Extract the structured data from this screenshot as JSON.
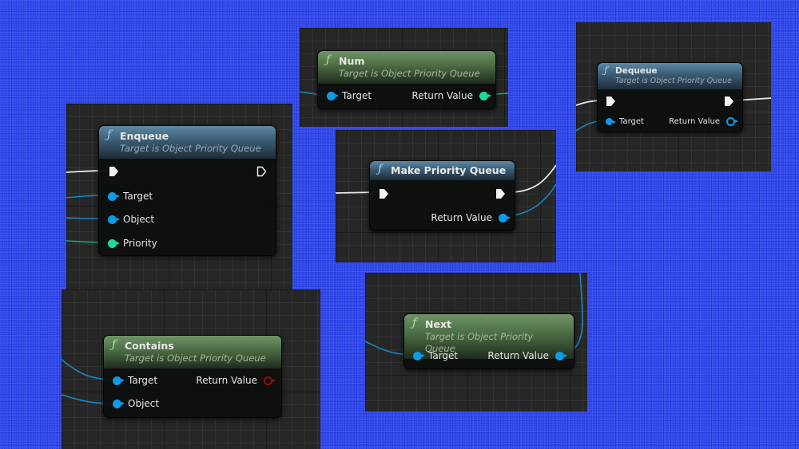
{
  "canvas": {
    "background_color": "#2f45e6",
    "graph_panel_color": "#262626"
  },
  "colors": {
    "object_pin": "#0d9be8",
    "integer_pin": "#1fd8a0",
    "boolean_pin": "#8b1010",
    "exec_pin": "#f2f2f2",
    "impure_header": "#4a7190",
    "pure_header": "#5a8052"
  },
  "nodes": {
    "num": {
      "icon": "function-icon",
      "fn_glyph": "ƒ",
      "title": "Num",
      "subtitle": "Target is Object Priority Queue",
      "inputs": [
        {
          "label": "Target",
          "type": "object"
        }
      ],
      "outputs": [
        {
          "label": "Return Value",
          "type": "integer"
        }
      ]
    },
    "dequeue": {
      "icon": "function-icon",
      "fn_glyph": "ƒ",
      "title": "Dequeue",
      "subtitle": "Target is Object Priority Queue",
      "inputs": [
        {
          "label": "Target",
          "type": "object"
        }
      ],
      "outputs": [
        {
          "label": "Return Value",
          "type": "object-unconnected"
        }
      ]
    },
    "enqueue": {
      "icon": "function-icon",
      "fn_glyph": "ƒ",
      "title": "Enqueue",
      "subtitle": "Target is Object Priority Queue",
      "inputs": [
        {
          "label": "Target",
          "type": "object"
        },
        {
          "label": "Object",
          "type": "object"
        },
        {
          "label": "Priority",
          "type": "integer"
        }
      ],
      "outputs": []
    },
    "make_priority_queue": {
      "icon": "function-icon",
      "fn_glyph": "ƒ",
      "title": "Make Priority Queue",
      "inputs": [],
      "outputs": [
        {
          "label": "Return Value",
          "type": "object"
        }
      ]
    },
    "contains": {
      "icon": "function-icon",
      "fn_glyph": "ƒ",
      "title": "Contains",
      "subtitle": "Target is Object Priority Queue",
      "inputs": [
        {
          "label": "Target",
          "type": "object"
        },
        {
          "label": "Object",
          "type": "object"
        }
      ],
      "outputs": [
        {
          "label": "Return Value",
          "type": "boolean-unconnected"
        }
      ]
    },
    "next": {
      "icon": "function-icon",
      "fn_glyph": "ƒ",
      "title": "Next",
      "subtitle": "Target is Object Priority Queue",
      "inputs": [
        {
          "label": "Target",
          "type": "object"
        }
      ],
      "outputs": [
        {
          "label": "Return Value",
          "type": "object"
        }
      ]
    }
  }
}
